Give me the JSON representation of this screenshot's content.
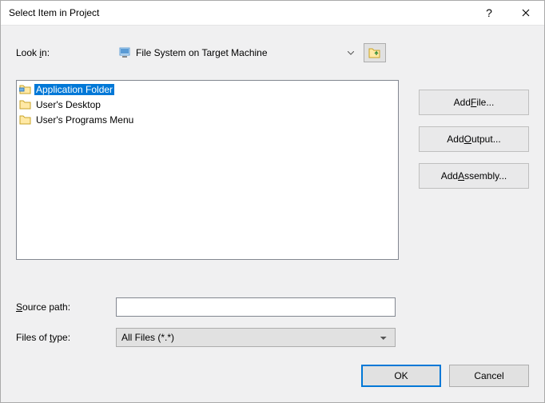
{
  "title": "Select Item in Project",
  "lookin_label_pre": "Look ",
  "lookin_label_u": "i",
  "lookin_label_post": "n:",
  "lookin_value": "File System on Target Machine",
  "items": [
    {
      "label": "Application Folder",
      "selected": true
    },
    {
      "label": "User's Desktop",
      "selected": false
    },
    {
      "label": "User's Programs Menu",
      "selected": false
    }
  ],
  "btn_addfile_pre": "Add ",
  "btn_addfile_u": "F",
  "btn_addfile_post": "ile...",
  "btn_addoutput_pre": "Add ",
  "btn_addoutput_u": "O",
  "btn_addoutput_post": "utput...",
  "btn_addasm_pre": "Add ",
  "btn_addasm_u": "A",
  "btn_addasm_post": "ssembly...",
  "sourcepath_pre": "",
  "sourcepath_u": "S",
  "sourcepath_post": "ource path:",
  "sourcepath_value": "",
  "filesoftype_pre": "Files of ",
  "filesoftype_u": "t",
  "filesoftype_post": "ype:",
  "filesoftype_value": "All Files (*.*)",
  "ok": "OK",
  "cancel": "Cancel",
  "help": "?"
}
